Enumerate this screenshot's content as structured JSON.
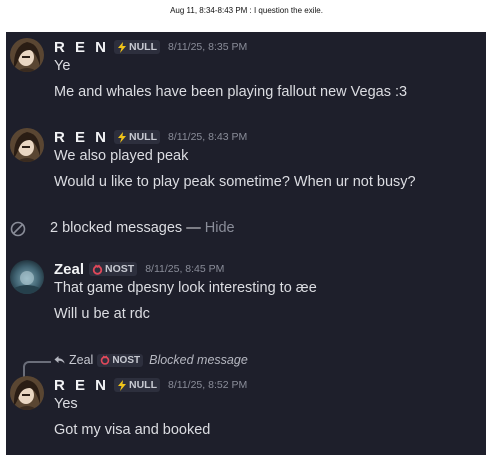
{
  "caption": "Aug 11, 8:34-8:43 PM : I question the exile.",
  "colors": {
    "chat_background": "#1e1f2b",
    "text": "#dcdde2",
    "muted": "#8a8d99",
    "ren_tag_icon": "#f0c419",
    "zeal_tag_icon": "#e0485a"
  },
  "messages": [
    {
      "author": "R E N",
      "tag_icon": "lightning-icon",
      "tag": "NULL",
      "time": "8/11/25, 8:35 PM",
      "lines": [
        "Ye",
        "Me and whales have been playing fallout new Vegas :3"
      ]
    },
    {
      "author": "R E N",
      "tag_icon": "lightning-icon",
      "tag": "NULL",
      "time": "8/11/25, 8:43 PM",
      "lines": [
        "We also played peak",
        "Would u like to play peak sometime? When ur not busy?"
      ]
    },
    {
      "author": "Zeal",
      "tag_icon": "ring-icon",
      "tag": "NOST",
      "time": "8/11/25, 8:45 PM",
      "lines": [
        "That game dpesny look interesting to æe",
        "Will u be at rdc"
      ]
    },
    {
      "author": "R E N",
      "tag_icon": "lightning-icon",
      "tag": "NULL",
      "time": "8/11/25, 8:52 PM",
      "lines": [
        "Yes",
        "Got my visa and booked"
      ]
    }
  ],
  "blocked": {
    "icon": "blocked-icon",
    "text": "2 blocked messages —",
    "hide": "Hide"
  },
  "reply": {
    "icon": "reply-arrow-icon",
    "author": "Zeal",
    "tag": "NOST",
    "note": "Blocked message"
  }
}
